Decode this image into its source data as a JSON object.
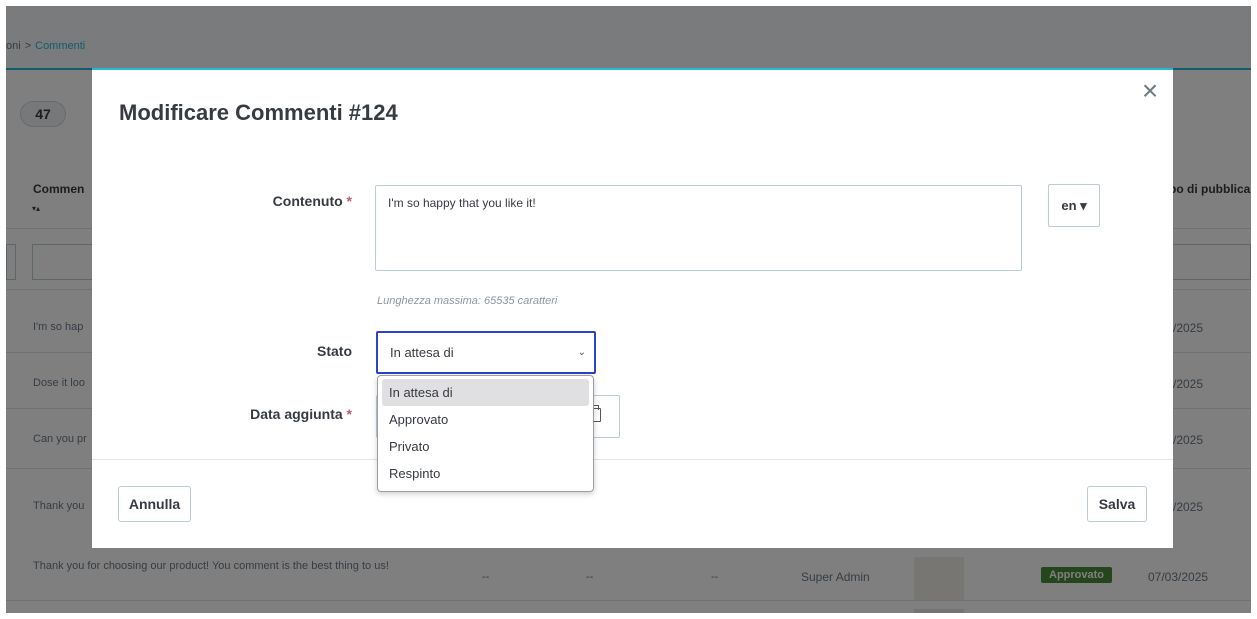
{
  "breadcrumb": {
    "parent": "oni",
    "separator": ">",
    "current": "Commenti"
  },
  "list": {
    "count": "47",
    "col_left": "Commen",
    "col_right": "po di pubblica",
    "sort_arrows": "▾▴",
    "rows": [
      {
        "text": "I'm so hap",
        "date": "/2025"
      },
      {
        "text": "Dose it loo",
        "date": "/2025"
      },
      {
        "text": "Can you pr",
        "date": "/2025"
      },
      {
        "text": "Thank you",
        "date": "/2025"
      }
    ],
    "row5": {
      "text": "Thank you for choosing our product! You comment is the best thing to us!",
      "dash1": "--",
      "dash2": "--",
      "dash3": "--",
      "author": "Super Admin",
      "status": "Approvato",
      "date": "07/03/2025"
    }
  },
  "modal": {
    "title": "Modificare Commenti #124",
    "close": "×",
    "content_label": "Contenuto",
    "required_mark": "*",
    "content_value": "I'm so happy that you like it!",
    "lang": "en ▾",
    "help": "Lunghezza massima: 65535 caratteri",
    "status_label": "Stato",
    "status_value": "In attesa di",
    "status_chevron": "⌄",
    "date_label": "Data aggiunta",
    "cancel": "Annulla",
    "save": "Salva"
  },
  "dropdown": {
    "options": [
      "In attesa di",
      "Approvato",
      "Privato",
      "Respinto"
    ]
  },
  "colors": {
    "accent": "#25b9d7",
    "focus": "#2c43c6",
    "required": "#c05c67",
    "approved": "#4b8b3b"
  }
}
